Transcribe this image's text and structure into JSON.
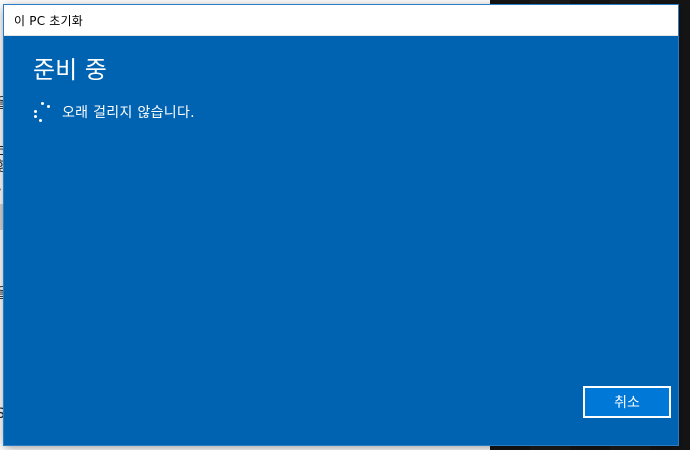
{
  "window": {
    "title": "이 PC 초기화"
  },
  "main": {
    "heading": "준비 중",
    "status_text": "오래 걸리지 않습니다.",
    "spinner_icon": "loading-spinner-icon"
  },
  "buttons": {
    "cancel_label": "취소"
  },
  "background": {
    "fragments": [
      "을",
      "는",
      "행",
      "\\",
      "을",
      "S"
    ]
  },
  "colors": {
    "dialog_background": "#0063b1",
    "button_background": "#0078d7",
    "titlebar_background": "#ffffff",
    "text": "#ffffff"
  }
}
